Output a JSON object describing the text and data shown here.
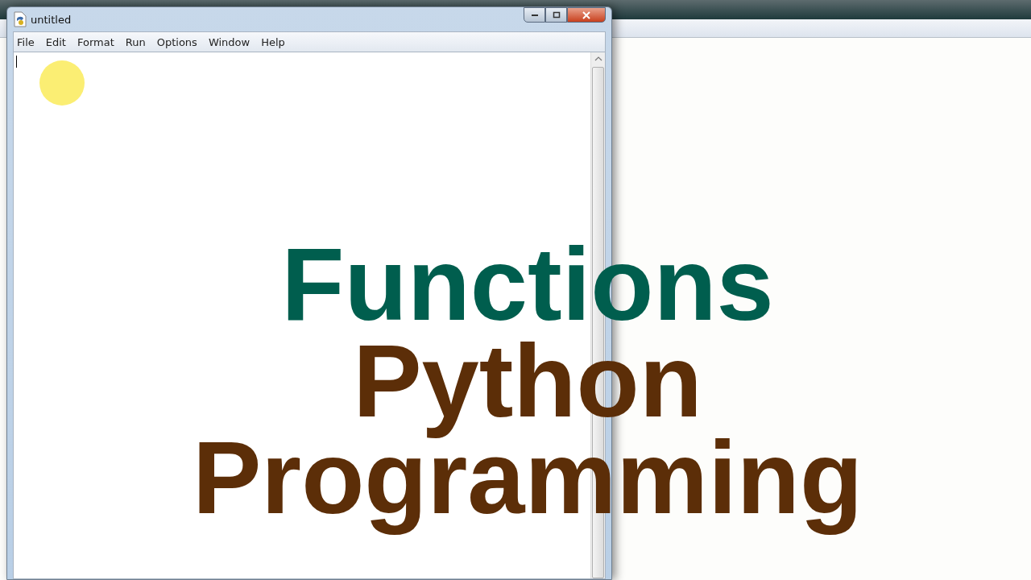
{
  "window": {
    "title": "untitled"
  },
  "menu": [
    {
      "label": "File"
    },
    {
      "label": "Edit"
    },
    {
      "label": "Format"
    },
    {
      "label": "Run"
    },
    {
      "label": "Options"
    },
    {
      "label": "Window"
    },
    {
      "label": "Help"
    }
  ],
  "overlay_title": [
    {
      "text": "Functions",
      "kind": "topic"
    },
    {
      "text": "Python",
      "kind": "subject"
    },
    {
      "text": "Programming",
      "kind": "subject"
    }
  ]
}
